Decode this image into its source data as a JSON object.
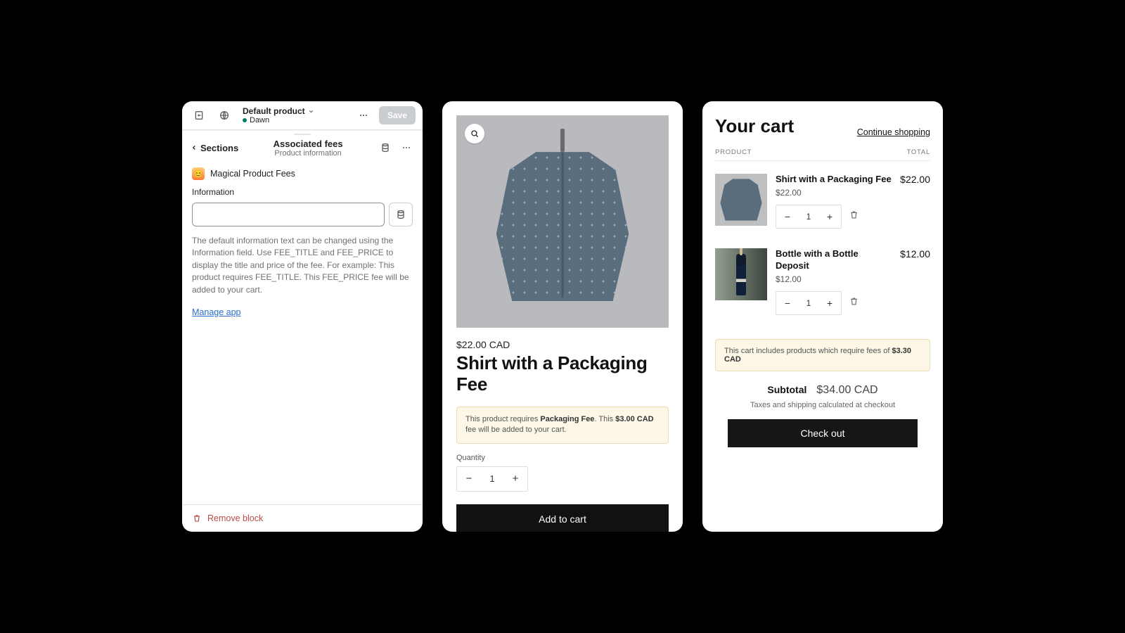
{
  "editor": {
    "product_label": "Default product",
    "theme_label": "Dawn",
    "save_label": "Save",
    "back_label": "Sections",
    "section_title": "Associated fees",
    "section_sub": "Product information",
    "block_name": "Magical Product Fees",
    "field_label": "Information",
    "help_text": "The default information text can be changed using the Information field. Use FEE_TITLE and FEE_PRICE to display the title and price of the fee. For example: This product requires FEE_TITLE. This FEE_PRICE fee will be added to your cart.",
    "manage_link": "Manage app",
    "remove_label": "Remove block"
  },
  "product": {
    "price": "$22.00 CAD",
    "title": "Shirt with a Packaging Fee",
    "notice_pre": "This product requires ",
    "notice_fee": "Packaging Fee",
    "notice_mid": ". This ",
    "notice_price": "$3.00 CAD",
    "notice_post": " fee will be added to your cart.",
    "qty_label": "Quantity",
    "qty_value": "1",
    "add_label": "Add to cart"
  },
  "cart": {
    "title": "Your cart",
    "continue": "Continue shopping",
    "col_product": "PRODUCT",
    "col_total": "TOTAL",
    "items": [
      {
        "name": "Shirt with a Packaging Fee",
        "price": "$22.00",
        "qty": "1",
        "line_total": "$22.00"
      },
      {
        "name": "Bottle with a Bottle Deposit",
        "price": "$12.00",
        "qty": "1",
        "line_total": "$12.00"
      }
    ],
    "notice_pre": "This cart includes products which require fees of ",
    "notice_amount": "$3.30 CAD",
    "subtotal_label": "Subtotal",
    "subtotal_value": "$34.00 CAD",
    "tax_note": "Taxes and shipping calculated at checkout",
    "checkout_label": "Check out"
  }
}
